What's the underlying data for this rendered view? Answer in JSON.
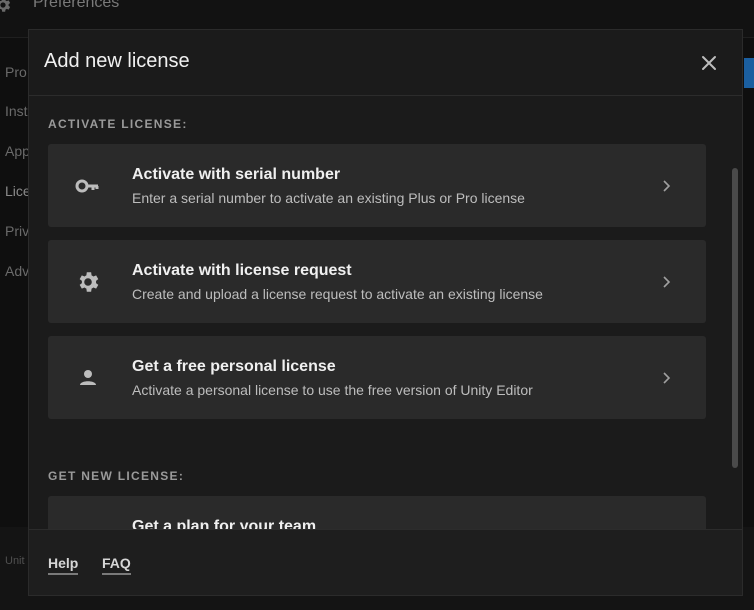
{
  "background": {
    "title": "Preferences",
    "sidebar_items": [
      "Pro",
      "Inst",
      "App",
      "Lice",
      "Priv",
      "Adv"
    ],
    "footer_text": "Unit"
  },
  "modal": {
    "title": "Add new license",
    "sections": [
      {
        "label": "ACTIVATE LICENSE:",
        "cards": [
          {
            "icon": "key-icon",
            "title": "Activate with serial number",
            "description": "Enter a serial number to activate an existing Plus or Pro license"
          },
          {
            "icon": "gear-icon",
            "title": "Activate with license request",
            "description": "Create and upload a license request to activate an existing license"
          },
          {
            "icon": "person-icon",
            "title": "Get a free personal license",
            "description": "Activate a personal license to use the free version of Unity Editor"
          }
        ]
      },
      {
        "label": "GET NEW LICENSE:",
        "cards": [
          {
            "title": "Get a plan for your team"
          }
        ]
      }
    ],
    "footer_links": [
      "Help",
      "FAQ"
    ]
  },
  "colors": {
    "overlay": "#0f0f0f",
    "modal_bg": "#1b1b1b",
    "card_bg": "#2a2a2a",
    "accent_blue": "#1b5fa0"
  }
}
